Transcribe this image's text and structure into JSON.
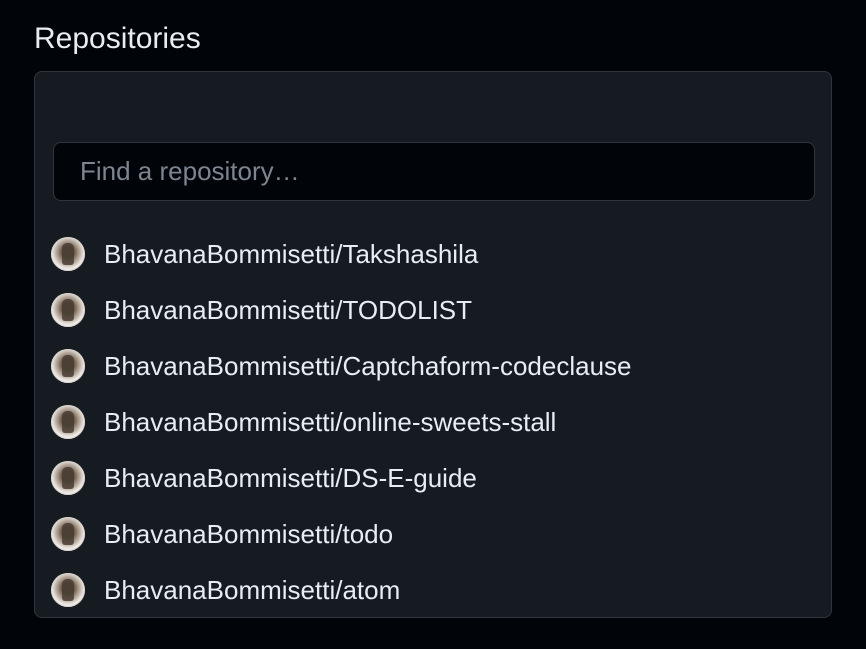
{
  "section": {
    "title": "Repositories"
  },
  "search": {
    "placeholder": "Find a repository…",
    "value": ""
  },
  "repositories": [
    {
      "owner": "BhavanaBommisetti",
      "name": "Takshashila"
    },
    {
      "owner": "BhavanaBommisetti",
      "name": "TODOLIST"
    },
    {
      "owner": "BhavanaBommisetti",
      "name": "Captchaform-codeclause"
    },
    {
      "owner": "BhavanaBommisetti",
      "name": "online-sweets-stall"
    },
    {
      "owner": "BhavanaBommisetti",
      "name": "DS-E-guide"
    },
    {
      "owner": "BhavanaBommisetti",
      "name": "todo"
    },
    {
      "owner": "BhavanaBommisetti",
      "name": "atom"
    }
  ],
  "colors": {
    "background": "#010409",
    "panel": "#161b22",
    "border": "#30363d",
    "text": "#e6edf3",
    "placeholder": "#7d8590"
  }
}
